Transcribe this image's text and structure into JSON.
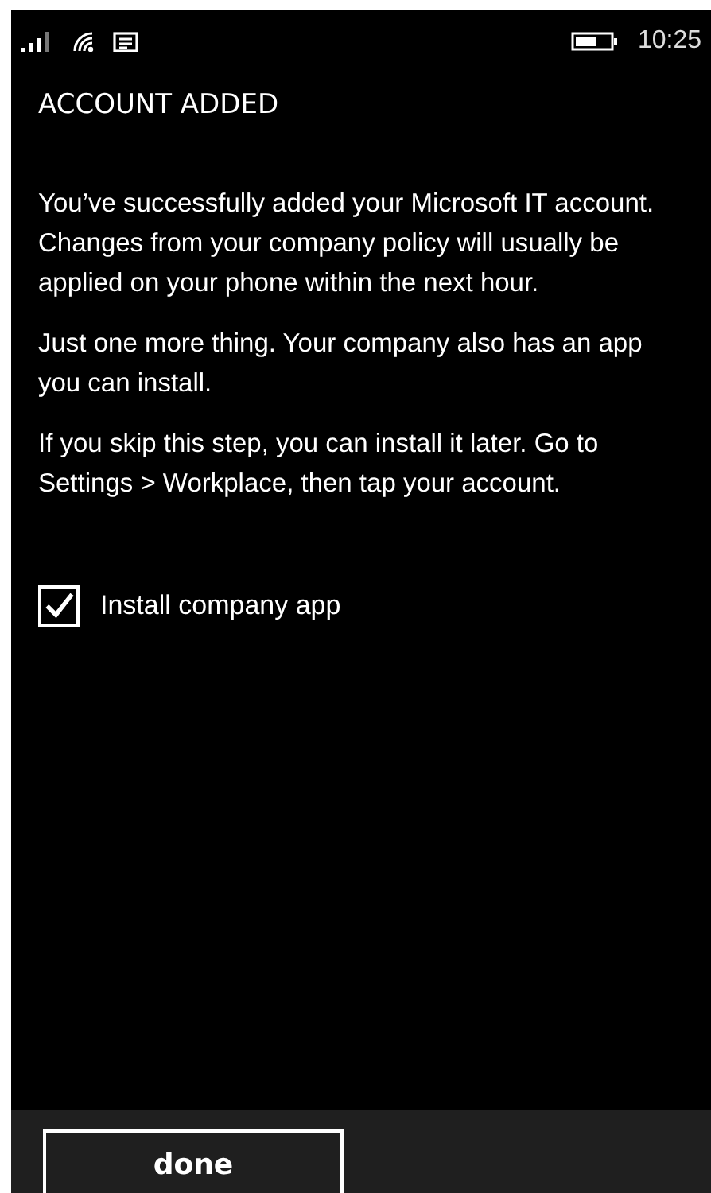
{
  "status_bar": {
    "time": "10:25"
  },
  "title": "ACCOUNT ADDED",
  "paragraphs": [
    "You’ve successfully added your Microsoft IT account. Changes from your company policy will usually be applied on your phone within the next hour.",
    "Just one more thing. Your company also has an app you can install.",
    "If you skip this step, you can install it later. Go to Settings > Workplace, then tap your account."
  ],
  "checkbox": {
    "label": "Install company app",
    "checked": true
  },
  "app_bar": {
    "button": "done"
  }
}
